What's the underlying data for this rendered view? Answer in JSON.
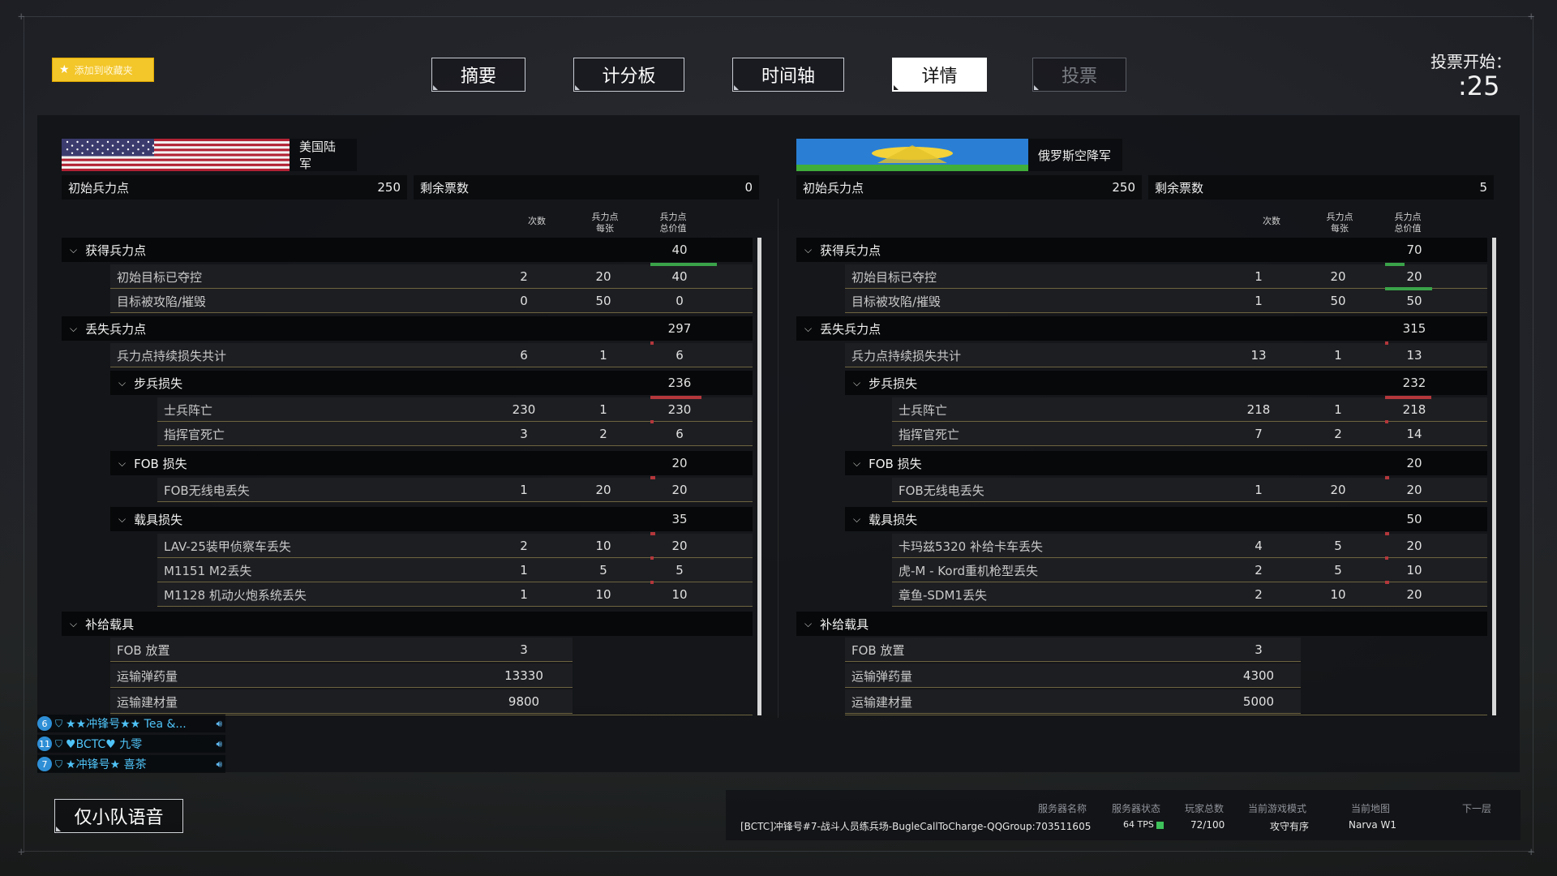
{
  "favorites_label": "添加到收藏夹",
  "tabs": [
    {
      "label": "摘要",
      "state": "normal"
    },
    {
      "label": "计分板",
      "state": "normal"
    },
    {
      "label": "时间轴",
      "state": "normal"
    },
    {
      "label": "详情",
      "state": "active"
    },
    {
      "label": "投票",
      "state": "disabled"
    }
  ],
  "vote": {
    "label": "投票开始：",
    "countdown": ":25"
  },
  "columns": {
    "count": "次数",
    "per": "兵力点\n每张",
    "total": "兵力点\n总价值"
  },
  "teams": [
    {
      "name": "美国陆军",
      "flag": "us-flag",
      "initial_label": "初始兵力点",
      "initial_value": "250",
      "tickets_label": "剩余票数",
      "tickets_value": "0",
      "gained": {
        "label": "获得兵力点",
        "total": "40",
        "items": [
          {
            "label": "初始目标已夺控",
            "count": "2",
            "per": "20",
            "total": "40",
            "bar": 1.0,
            "color": "green"
          },
          {
            "label": "目标被攻陷/摧毁",
            "count": "0",
            "per": "50",
            "total": "0",
            "bar": 0,
            "color": "green"
          }
        ]
      },
      "lost": {
        "label": "丢失兵力点",
        "total": "297",
        "bleed": {
          "label": "兵力点持续损失共计",
          "count": "6",
          "per": "1",
          "total": "6",
          "bar": 0.03
        },
        "groups": [
          {
            "label": "步兵损失",
            "total": "236",
            "items": [
              {
                "label": "士兵阵亡",
                "count": "230",
                "per": "1",
                "total": "230",
                "bar": 0.77
              },
              {
                "label": "指挥官死亡",
                "count": "3",
                "per": "2",
                "total": "6",
                "bar": 0.03
              }
            ]
          },
          {
            "label": "FOB 损失",
            "total": "20",
            "items": [
              {
                "label": "FOB无线电丢失",
                "count": "1",
                "per": "20",
                "total": "20",
                "bar": 0.07
              }
            ]
          },
          {
            "label": "载具损失",
            "total": "35",
            "items": [
              {
                "label": "LAV-25装甲侦察车丢失",
                "count": "2",
                "per": "10",
                "total": "20",
                "bar": 0.07
              },
              {
                "label": "M1151 M2丢失",
                "count": "1",
                "per": "5",
                "total": "5",
                "bar": 0.03
              },
              {
                "label": "M1128 机动火炮系统丢失",
                "count": "1",
                "per": "10",
                "total": "10",
                "bar": 0.04
              }
            ]
          }
        ]
      },
      "logistics": {
        "label": "补给载具",
        "items": [
          {
            "label": "FOB 放置",
            "value": "3"
          },
          {
            "label": "运输弹药量",
            "value": "13330"
          },
          {
            "label": "运输建材量",
            "value": "9800"
          }
        ]
      }
    },
    {
      "name": "俄罗斯空降军",
      "flag": "vdv-flag",
      "initial_label": "初始兵力点",
      "initial_value": "250",
      "tickets_label": "剩余票数",
      "tickets_value": "5",
      "gained": {
        "label": "获得兵力点",
        "total": "70",
        "items": [
          {
            "label": "初始目标已夺控",
            "count": "1",
            "per": "20",
            "total": "20",
            "bar": 0.29,
            "color": "green"
          },
          {
            "label": "目标被攻陷/摧毁",
            "count": "1",
            "per": "50",
            "total": "50",
            "bar": 0.71,
            "color": "green"
          }
        ]
      },
      "lost": {
        "label": "丢失兵力点",
        "total": "315",
        "bleed": {
          "label": "兵力点持续损失共计",
          "count": "13",
          "per": "1",
          "total": "13",
          "bar": 0.05
        },
        "groups": [
          {
            "label": "步兵损失",
            "total": "232",
            "items": [
              {
                "label": "士兵阵亡",
                "count": "218",
                "per": "1",
                "total": "218",
                "bar": 0.69
              },
              {
                "label": "指挥官死亡",
                "count": "7",
                "per": "2",
                "total": "14",
                "bar": 0.05
              }
            ]
          },
          {
            "label": "FOB 损失",
            "total": "20",
            "items": [
              {
                "label": "FOB无线电丢失",
                "count": "1",
                "per": "20",
                "total": "20",
                "bar": 0.06
              }
            ]
          },
          {
            "label": "载具损失",
            "total": "50",
            "items": [
              {
                "label": "卡玛兹5320 补给卡车丢失",
                "count": "4",
                "per": "5",
                "total": "20",
                "bar": 0.06
              },
              {
                "label": "虎-M - Kord重机枪型丢失",
                "count": "2",
                "per": "5",
                "total": "10",
                "bar": 0.04
              },
              {
                "label": "章鱼-SDM1丢失",
                "count": "2",
                "per": "10",
                "total": "20",
                "bar": 0.06
              }
            ]
          }
        ]
      },
      "logistics": {
        "label": "补给载具",
        "items": [
          {
            "label": "FOB 放置",
            "value": "3"
          },
          {
            "label": "运输弹药量",
            "value": "4300"
          },
          {
            "label": "运输建材量",
            "value": "5000"
          }
        ]
      }
    }
  ],
  "voice": [
    {
      "badge": "6",
      "name": "★★冲锋号★★ Tea &..."
    },
    {
      "badge": "11",
      "name": "♥BCTC♥ 九零"
    },
    {
      "badge": "7",
      "name": "★冲锋号★ 喜茶"
    }
  ],
  "squad_voice_label": "仅小队语音",
  "server": {
    "name_header": "服务器名称",
    "name": "[BCTC]冲锋号#7-战斗人员练兵场-BugleCallToCharge-QQGroup:703511605",
    "status_header": "服务器状态",
    "status": "64 TPS",
    "players_header": "玩家总数",
    "players": "72/100",
    "mode_header": "当前游戏模式",
    "mode": "攻守有序",
    "map_header": "当前地图",
    "map": "Narva W1",
    "next_header": "下一层"
  }
}
